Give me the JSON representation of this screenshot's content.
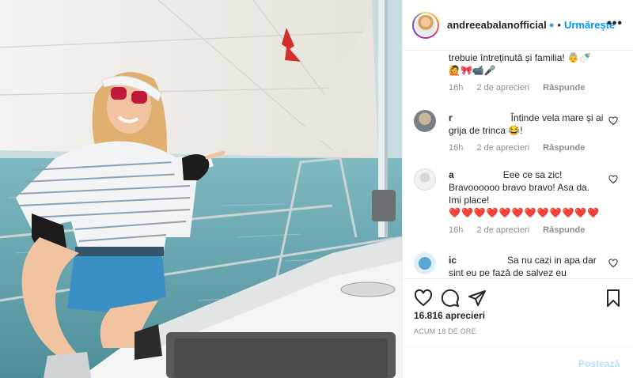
{
  "post": {
    "username": "andreeabalanofficial",
    "follow_label": "Urmărește",
    "dot": "•",
    "verified_icon": "verified-badge-icon",
    "more_icon": "more-options-icon"
  },
  "comments": [
    {
      "partial": true,
      "text": "trebuie întreținută și familia! 👵🍼",
      "text2": "🙋🎀📹🎤",
      "time": "16h",
      "likes": "2 de aprecieri",
      "reply": "Răspunde"
    },
    {
      "username": "r",
      "text": "Întinde vela mare și ai grija de trinca 😂!",
      "time": "16h",
      "likes": "2 de aprecieri",
      "reply": "Răspunde"
    },
    {
      "username": "a",
      "text": "Eee ce sa zic! Bravoooooo bravo bravo! Asa da. Imi place!",
      "hearts": "❤️❤️❤️❤️❤️❤️❤️❤️❤️❤️❤️❤️",
      "time": "16h",
      "likes": "2 de aprecieri",
      "reply": "Răspunde"
    },
    {
      "username": "ic",
      "text": "Sa nu cazi in apa dar sint eu pe fază de salvez eu"
    }
  ],
  "stats": {
    "likes": "16.816 aprecieri",
    "time_ago": "ACUM 18 DE ORE"
  },
  "composer": {
    "post_label": "Postează"
  },
  "colors": {
    "accent": "#0095f6",
    "meta": "#8e8e8e",
    "heart": "#ed4956"
  }
}
